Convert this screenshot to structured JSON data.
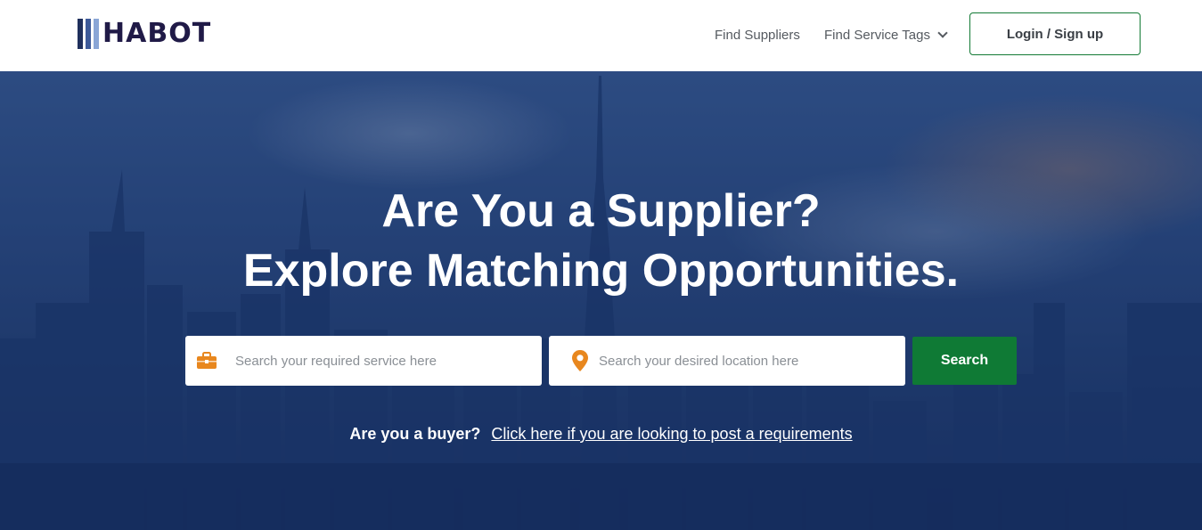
{
  "header": {
    "logo_text": "HABOT",
    "logo_bar_colors": [
      "#1f2f5c",
      "#3d5a99",
      "#8aa6d6"
    ],
    "nav": {
      "find_suppliers": "Find Suppliers",
      "find_service_tags": "Find Service Tags"
    },
    "login_label": "Login / Sign up"
  },
  "hero": {
    "title": "Are You a Supplier?",
    "subtitle": "Explore Matching Opportunities.",
    "search": {
      "service_placeholder": "Search your required service here",
      "location_placeholder": "Search your desired location here",
      "button_label": "Search"
    },
    "buyer": {
      "question": "Are you a buyer?",
      "link_text": "Click here if you are looking to post a requirements"
    }
  },
  "colors": {
    "accent_green": "#0f7a35",
    "icon_orange": "#e8871e",
    "logo_text": "#201a47"
  },
  "icons": {
    "service": "briefcase-icon",
    "location": "map-pin-icon",
    "dropdown": "chevron-down-icon"
  }
}
